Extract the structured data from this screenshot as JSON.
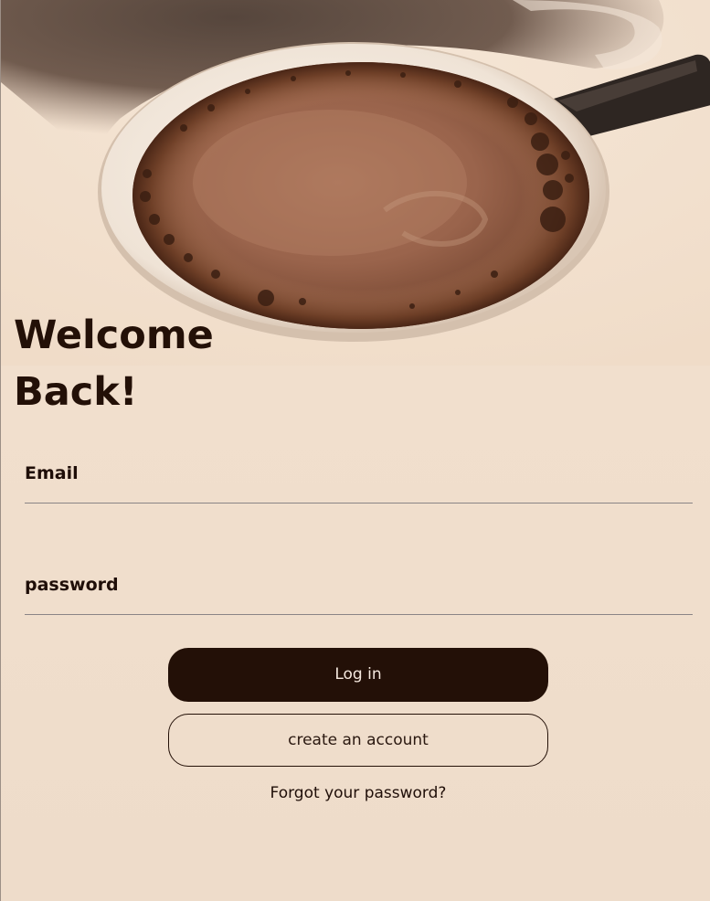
{
  "colors": {
    "background": "#f1dfcd",
    "primary": "#231007",
    "text": "#1f0e08",
    "underline": "#8a8486"
  },
  "hero": {
    "icon": "coffee-cup-photo"
  },
  "title": "Welcome Back!",
  "form": {
    "email": {
      "label": "Email",
      "value": ""
    },
    "password": {
      "label": "password",
      "value": ""
    }
  },
  "actions": {
    "login_label": "Log in",
    "create_account_label": "create an account",
    "forgot_label": "Forgot your password?"
  }
}
